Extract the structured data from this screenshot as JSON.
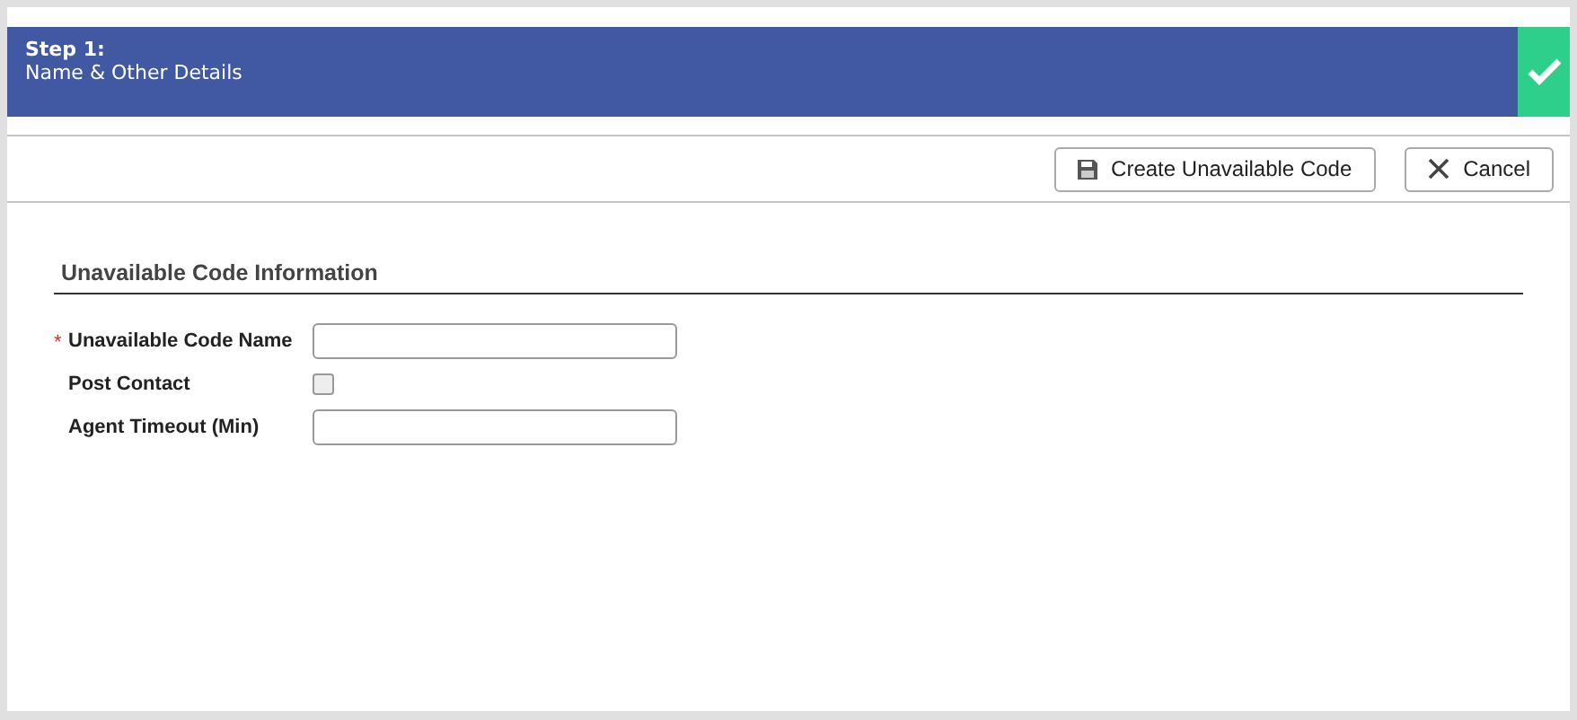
{
  "step": {
    "title": "Step 1:",
    "subtitle": "Name & Other Details",
    "complete": true
  },
  "buttons": [
    {
      "label": "Create Unavailable Code",
      "kind": "save"
    },
    {
      "label": "Cancel",
      "kind": "cancel"
    }
  ],
  "section": {
    "title": "Unavailable Code Information"
  },
  "fields": [
    {
      "label": "Unavailable Code Name",
      "kind": "text",
      "required_mark": "*"
    },
    {
      "label": "Post Contact",
      "kind": "checkbox",
      "checked": false
    },
    {
      "label": "Agent Timeout (Min)",
      "kind": "text"
    }
  ]
}
